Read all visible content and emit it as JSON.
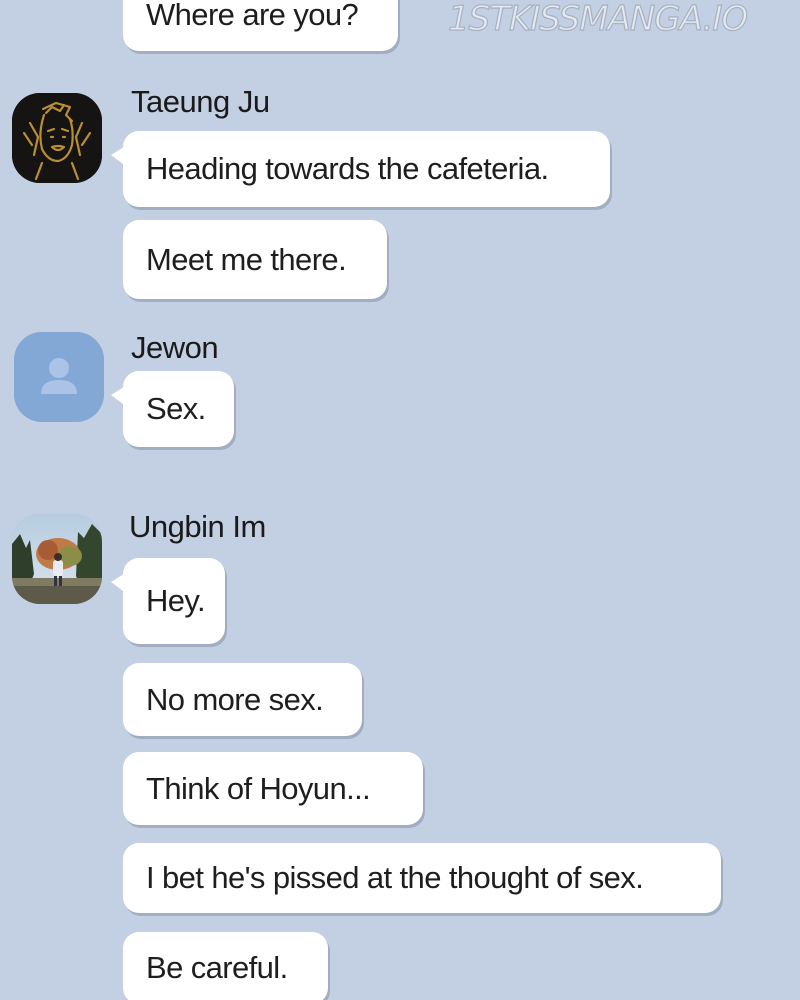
{
  "watermark": "1STKISSMANGA.IO",
  "messages": {
    "top": "Where are you?",
    "taeung": {
      "name": "Taeung Ju",
      "m1": "Heading towards the cafeteria.",
      "m2": "Meet me there."
    },
    "jewon": {
      "name": "Jewon",
      "m1": "Sex."
    },
    "ungbin": {
      "name": "Ungbin Im",
      "m1": "Hey.",
      "m2": "No more sex.",
      "m3": "Think of Hoyun...",
      "m4": "I bet he's pissed at the thought of sex.",
      "m5": "Be careful."
    }
  },
  "colors": {
    "background": "#c3cfe3",
    "bubble": "#ffffff",
    "default_avatar": "#84a8d6"
  },
  "icons": {
    "taeung_avatar": "sketch-face-avatar",
    "jewon_avatar": "default-person-icon",
    "ungbin_avatar": "park-photo-avatar"
  }
}
